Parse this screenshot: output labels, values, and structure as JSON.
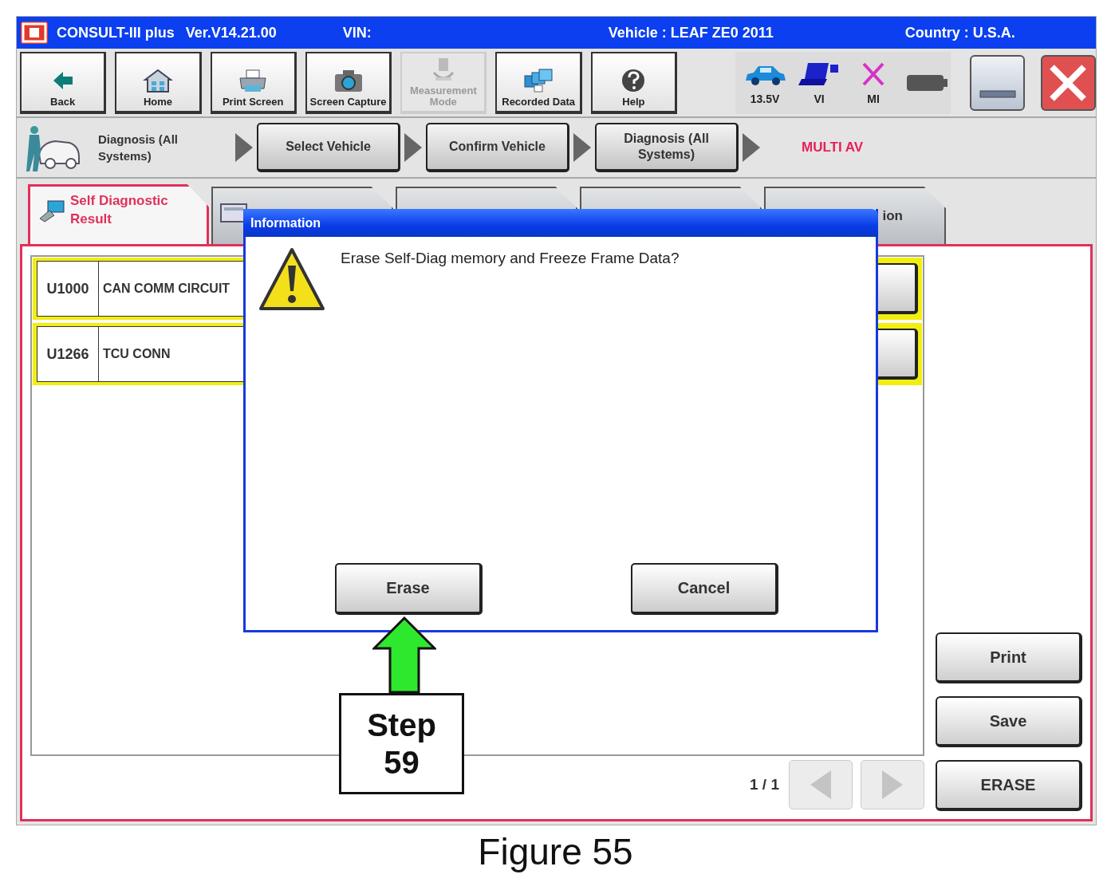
{
  "window": {
    "title": "CONSULT-III plus",
    "version": "Ver.V14.21.00",
    "vin_label": "VIN:",
    "vehicle": "Vehicle : LEAF ZE0 2011",
    "country": "Country : U.S.A."
  },
  "toolbar": [
    {
      "kind": "back",
      "label": "Back",
      "disabled": false
    },
    {
      "kind": "home",
      "label": "Home",
      "disabled": false
    },
    {
      "kind": "print",
      "label": "Print Screen",
      "disabled": false
    },
    {
      "kind": "camera",
      "label": "Screen Capture",
      "disabled": false
    },
    {
      "kind": "measure",
      "label": "Measurement Mode",
      "disabled": true
    },
    {
      "kind": "recorded",
      "label": "Recorded Data",
      "disabled": false
    },
    {
      "kind": "help",
      "label": "Help",
      "disabled": false
    }
  ],
  "status": [
    {
      "kind": "car",
      "label": "13.5V"
    },
    {
      "kind": "vi",
      "label": "VI"
    },
    {
      "kind": "mi",
      "label": "MI"
    },
    {
      "kind": "battery"
    }
  ],
  "breadcrumb": {
    "title": "Diagnosis (All Systems)",
    "steps": [
      "Select Vehicle",
      "Confirm Vehicle",
      "Diagnosis (All Systems)"
    ],
    "current": "MULTI AV"
  },
  "tabs": [
    {
      "label": "Self Diagnostic Result",
      "selected": true
    },
    {
      "selected": false
    },
    {
      "selected": false
    },
    {
      "selected": false
    },
    {
      "label": "ion",
      "selected": false
    }
  ],
  "results": [
    {
      "code": "U1000",
      "description": "CAN COMM CIRCUIT"
    },
    {
      "code": "U1266",
      "description": "TCU CONN"
    }
  ],
  "pager": {
    "text": "1 / 1",
    "buttons": [
      {
        "kind": "prev",
        "disabled": true
      },
      {
        "kind": "next",
        "disabled": true
      }
    ]
  },
  "side_buttons": [
    "Print",
    "Save",
    "ERASE"
  ],
  "dialog": {
    "title": "Information",
    "message": "Erase Self-Diag memory and Freeze Frame Data?",
    "buttons": [
      "Erase",
      "Cancel"
    ]
  },
  "callout": {
    "text": "Step\n59"
  },
  "caption": "Figure 55"
}
